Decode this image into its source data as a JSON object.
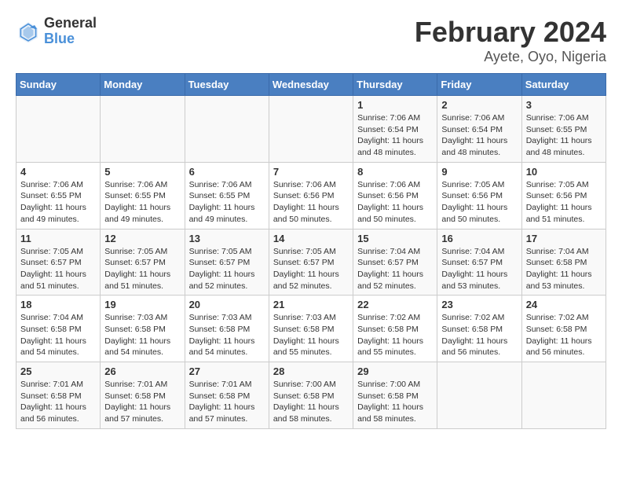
{
  "header": {
    "logo_line1": "General",
    "logo_line2": "Blue",
    "main_title": "February 2024",
    "sub_title": "Ayete, Oyo, Nigeria"
  },
  "days_of_week": [
    "Sunday",
    "Monday",
    "Tuesday",
    "Wednesday",
    "Thursday",
    "Friday",
    "Saturday"
  ],
  "weeks": [
    [
      {
        "day": "",
        "info": ""
      },
      {
        "day": "",
        "info": ""
      },
      {
        "day": "",
        "info": ""
      },
      {
        "day": "",
        "info": ""
      },
      {
        "day": "1",
        "info": "Sunrise: 7:06 AM\nSunset: 6:54 PM\nDaylight: 11 hours and 48 minutes."
      },
      {
        "day": "2",
        "info": "Sunrise: 7:06 AM\nSunset: 6:54 PM\nDaylight: 11 hours and 48 minutes."
      },
      {
        "day": "3",
        "info": "Sunrise: 7:06 AM\nSunset: 6:55 PM\nDaylight: 11 hours and 48 minutes."
      }
    ],
    [
      {
        "day": "4",
        "info": "Sunrise: 7:06 AM\nSunset: 6:55 PM\nDaylight: 11 hours and 49 minutes."
      },
      {
        "day": "5",
        "info": "Sunrise: 7:06 AM\nSunset: 6:55 PM\nDaylight: 11 hours and 49 minutes."
      },
      {
        "day": "6",
        "info": "Sunrise: 7:06 AM\nSunset: 6:55 PM\nDaylight: 11 hours and 49 minutes."
      },
      {
        "day": "7",
        "info": "Sunrise: 7:06 AM\nSunset: 6:56 PM\nDaylight: 11 hours and 50 minutes."
      },
      {
        "day": "8",
        "info": "Sunrise: 7:06 AM\nSunset: 6:56 PM\nDaylight: 11 hours and 50 minutes."
      },
      {
        "day": "9",
        "info": "Sunrise: 7:05 AM\nSunset: 6:56 PM\nDaylight: 11 hours and 50 minutes."
      },
      {
        "day": "10",
        "info": "Sunrise: 7:05 AM\nSunset: 6:56 PM\nDaylight: 11 hours and 51 minutes."
      }
    ],
    [
      {
        "day": "11",
        "info": "Sunrise: 7:05 AM\nSunset: 6:57 PM\nDaylight: 11 hours and 51 minutes."
      },
      {
        "day": "12",
        "info": "Sunrise: 7:05 AM\nSunset: 6:57 PM\nDaylight: 11 hours and 51 minutes."
      },
      {
        "day": "13",
        "info": "Sunrise: 7:05 AM\nSunset: 6:57 PM\nDaylight: 11 hours and 52 minutes."
      },
      {
        "day": "14",
        "info": "Sunrise: 7:05 AM\nSunset: 6:57 PM\nDaylight: 11 hours and 52 minutes."
      },
      {
        "day": "15",
        "info": "Sunrise: 7:04 AM\nSunset: 6:57 PM\nDaylight: 11 hours and 52 minutes."
      },
      {
        "day": "16",
        "info": "Sunrise: 7:04 AM\nSunset: 6:57 PM\nDaylight: 11 hours and 53 minutes."
      },
      {
        "day": "17",
        "info": "Sunrise: 7:04 AM\nSunset: 6:58 PM\nDaylight: 11 hours and 53 minutes."
      }
    ],
    [
      {
        "day": "18",
        "info": "Sunrise: 7:04 AM\nSunset: 6:58 PM\nDaylight: 11 hours and 54 minutes."
      },
      {
        "day": "19",
        "info": "Sunrise: 7:03 AM\nSunset: 6:58 PM\nDaylight: 11 hours and 54 minutes."
      },
      {
        "day": "20",
        "info": "Sunrise: 7:03 AM\nSunset: 6:58 PM\nDaylight: 11 hours and 54 minutes."
      },
      {
        "day": "21",
        "info": "Sunrise: 7:03 AM\nSunset: 6:58 PM\nDaylight: 11 hours and 55 minutes."
      },
      {
        "day": "22",
        "info": "Sunrise: 7:02 AM\nSunset: 6:58 PM\nDaylight: 11 hours and 55 minutes."
      },
      {
        "day": "23",
        "info": "Sunrise: 7:02 AM\nSunset: 6:58 PM\nDaylight: 11 hours and 56 minutes."
      },
      {
        "day": "24",
        "info": "Sunrise: 7:02 AM\nSunset: 6:58 PM\nDaylight: 11 hours and 56 minutes."
      }
    ],
    [
      {
        "day": "25",
        "info": "Sunrise: 7:01 AM\nSunset: 6:58 PM\nDaylight: 11 hours and 56 minutes."
      },
      {
        "day": "26",
        "info": "Sunrise: 7:01 AM\nSunset: 6:58 PM\nDaylight: 11 hours and 57 minutes."
      },
      {
        "day": "27",
        "info": "Sunrise: 7:01 AM\nSunset: 6:58 PM\nDaylight: 11 hours and 57 minutes."
      },
      {
        "day": "28",
        "info": "Sunrise: 7:00 AM\nSunset: 6:58 PM\nDaylight: 11 hours and 58 minutes."
      },
      {
        "day": "29",
        "info": "Sunrise: 7:00 AM\nSunset: 6:58 PM\nDaylight: 11 hours and 58 minutes."
      },
      {
        "day": "",
        "info": ""
      },
      {
        "day": "",
        "info": ""
      }
    ]
  ]
}
